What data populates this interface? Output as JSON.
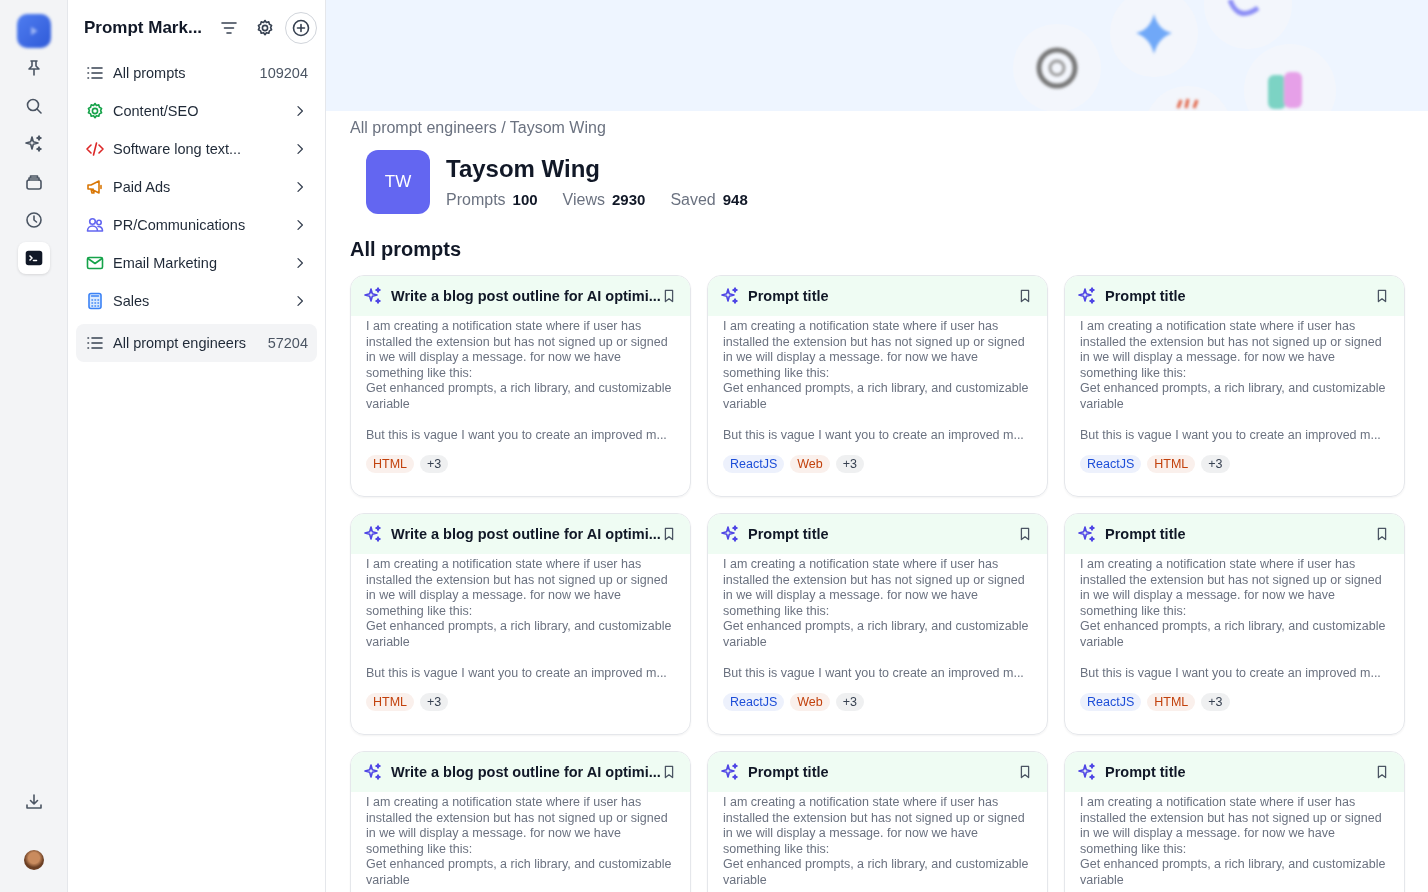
{
  "rail": {
    "items": [
      {
        "selected": false
      },
      {
        "selected": false
      },
      {
        "selected": false
      },
      {
        "selected": false
      },
      {
        "selected": false
      },
      {
        "selected": true
      }
    ]
  },
  "sidebar": {
    "title": "Prompt Mark...",
    "items": [
      {
        "kind": "total",
        "label": "All prompts",
        "count": "109204",
        "selected": false
      },
      {
        "kind": "category",
        "label": "Content/SEO",
        "selected": false
      },
      {
        "kind": "category",
        "label": "Software long text...",
        "selected": false
      },
      {
        "kind": "category",
        "label": "Paid Ads",
        "selected": false
      },
      {
        "kind": "category",
        "label": "PR/Communications",
        "selected": false
      },
      {
        "kind": "category",
        "label": "Email Marketing",
        "selected": false
      },
      {
        "kind": "category",
        "label": "Sales",
        "selected": false
      },
      {
        "kind": "total",
        "label": "All prompt engineers",
        "count": "57204",
        "selected": true
      }
    ]
  },
  "breadcrumb": "All prompt engineers / Taysom Wing",
  "profile": {
    "initials": "TW",
    "name": "Taysom Wing",
    "stats": [
      {
        "label": "Prompts",
        "value": "100"
      },
      {
        "label": "Views",
        "value": "2930"
      },
      {
        "label": "Saved",
        "value": "948"
      }
    ]
  },
  "section_title": "All prompts",
  "cards": [
    {
      "title": "Write a blog post outline for AI optimi...",
      "body": "I am creating a notification state where if user has installed the extension but has not signed up or signed in we will display a message. for now we have\nsomething like this:\nGet enhanced prompts, a rich library, and customizable variable\n\nBut this is vague I want you to create an improved m...",
      "tags": [
        {
          "label": "HTML",
          "color": "#c2410c"
        },
        {
          "label": "+3",
          "color": "#374151"
        }
      ]
    },
    {
      "title": "Prompt title",
      "body": "I am creating a notification state where if user has installed the extension but has not signed up or signed in we will display a message. for now we have\nsomething like this:\nGet enhanced prompts, a rich library, and customizable variable\n\nBut this is vague I want you to create an improved m...",
      "tags": [
        {
          "label": "ReactJS",
          "color": "#1d4ed8"
        },
        {
          "label": "Web",
          "color": "#c2410c"
        },
        {
          "label": "+3",
          "color": "#374151"
        }
      ]
    },
    {
      "title": "Prompt title",
      "body": "I am creating a notification state where if user has installed the extension but has not signed up or signed in we will display a message. for now we have\nsomething like this:\nGet enhanced prompts, a rich library, and customizable variable\n\nBut this is vague I want you to create an improved m...",
      "tags": [
        {
          "label": "ReactJS",
          "color": "#1d4ed8"
        },
        {
          "label": "HTML",
          "color": "#c2410c"
        },
        {
          "label": "+3",
          "color": "#374151"
        }
      ]
    },
    {
      "title": "Write a blog post outline for AI optimi...",
      "body": "I am creating a notification state where if user has installed the extension but has not signed up or signed in we will display a message. for now we have\nsomething like this:\nGet enhanced prompts, a rich library, and customizable variable\n\nBut this is vague I want you to create an improved m...",
      "tags": [
        {
          "label": "HTML",
          "color": "#c2410c"
        },
        {
          "label": "+3",
          "color": "#374151"
        }
      ]
    },
    {
      "title": "Prompt title",
      "body": "I am creating a notification state where if user has installed the extension but has not signed up or signed in we will display a message. for now we have\nsomething like this:\nGet enhanced prompts, a rich library, and customizable variable\n\nBut this is vague I want you to create an improved m...",
      "tags": [
        {
          "label": "ReactJS",
          "color": "#1d4ed8"
        },
        {
          "label": "Web",
          "color": "#c2410c"
        },
        {
          "label": "+3",
          "color": "#374151"
        }
      ]
    },
    {
      "title": "Prompt title",
      "body": "I am creating a notification state where if user has installed the extension but has not signed up or signed in we will display a message. for now we have\nsomething like this:\nGet enhanced prompts, a rich library, and customizable variable\n\nBut this is vague I want you to create an improved m...",
      "tags": [
        {
          "label": "ReactJS",
          "color": "#1d4ed8"
        },
        {
          "label": "HTML",
          "color": "#c2410c"
        },
        {
          "label": "+3",
          "color": "#374151"
        }
      ]
    },
    {
      "title": "Write a blog post outline for AI optimi...",
      "body": "I am creating a notification state where if user has installed the extension but has not signed up or signed in we will display a message. for now we have\nsomething like this:\nGet enhanced prompts, a rich library, and customizable variable"
    },
    {
      "title": "Prompt title",
      "body": "I am creating a notification state where if user has installed the extension but has not signed up or signed in we will display a message. for now we have\nsomething like this:\nGet enhanced prompts, a rich library, and customizable variable"
    },
    {
      "title": "Prompt title",
      "body": "I am creating a notification state where if user has installed the extension but has not signed up or signed in we will display a message. for now we have\nsomething like this:\nGet enhanced prompts, a rich library, and customizable variable"
    }
  ]
}
